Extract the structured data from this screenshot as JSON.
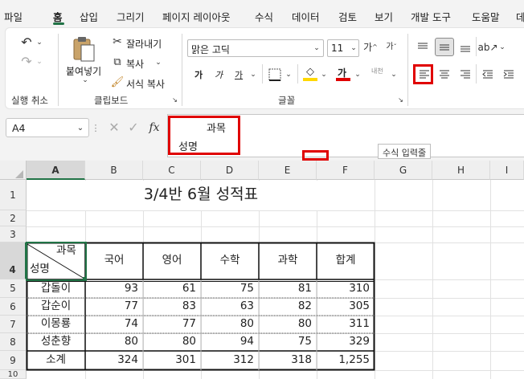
{
  "menu_tabs": [
    "파일",
    "홈",
    "삽입",
    "그리기",
    "페이지 레이아웃",
    "수식",
    "데이터",
    "검토",
    "보기",
    "개발 도구",
    "도움말",
    "데"
  ],
  "clipboard": {
    "paste": "붙여넣기",
    "cut": "잘라내기",
    "copy": "복사",
    "format_painter": "서식 복사",
    "group_label": "클립보드"
  },
  "undo_group_label": "실행 취소",
  "font": {
    "name": "맑은 고딕",
    "size": "11",
    "group_label": "글꼴",
    "bold": "가",
    "italic": "가",
    "underline": "가",
    "font_color_glyph": "가",
    "phonetic": "내천"
  },
  "formula": {
    "cell_ref": "A4",
    "fx": "fx",
    "line1": "과목",
    "line2": "성명",
    "tooltip": "수식 입력줄"
  },
  "columns": [
    "A",
    "B",
    "C",
    "D",
    "E",
    "F",
    "G",
    "H",
    "I"
  ],
  "rows": [
    "1",
    "2",
    "3",
    "4",
    "5",
    "6",
    "7",
    "8",
    "9",
    "10"
  ],
  "sheet": {
    "title": "3/4반 6월 성적표",
    "header_top": "과목",
    "header_bottom": "성명",
    "subjects": [
      "국어",
      "영어",
      "수학",
      "과학",
      "합계"
    ],
    "students": [
      {
        "name": "갑돌이",
        "scores": [
          "93",
          "61",
          "75",
          "81",
          "310"
        ]
      },
      {
        "name": "갑순이",
        "scores": [
          "77",
          "83",
          "63",
          "82",
          "305"
        ]
      },
      {
        "name": "이몽룡",
        "scores": [
          "74",
          "77",
          "80",
          "80",
          "311"
        ]
      },
      {
        "name": "성춘향",
        "scores": [
          "80",
          "80",
          "94",
          "75",
          "329"
        ]
      }
    ],
    "total": {
      "name": "소계",
      "scores": [
        "324",
        "301",
        "312",
        "318",
        "1,255"
      ]
    }
  },
  "colors": {
    "accent": "#217346",
    "highlight_red": "#e00000",
    "fill_yellow": "#ffd800",
    "font_red": "#e00000"
  }
}
